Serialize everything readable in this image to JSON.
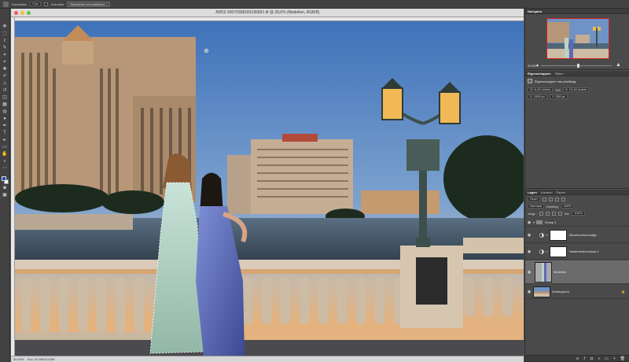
{
  "options_bar": {
    "feather_label": "Doezelaar:",
    "feather_value": "0 px",
    "antialias_label": "Anti-alias",
    "select_mask_button": "Selecteren en maskeren..."
  },
  "document": {
    "title": "JWD2-20070308183195891.tif @ 39,6% (Modellen, RGB/8)",
    "status_zoom": "39,53%",
    "status_doc": "Doc: 32,5M/104,9M"
  },
  "colors": {
    "foreground": "#1b4fb8",
    "background": "#ffffff",
    "selection_frame": "#cf2020"
  },
  "navigator": {
    "tab": "Navigator",
    "zoom": "39,53%"
  },
  "properties": {
    "tabs": [
      "Eigenschappen",
      "Stijlen"
    ],
    "heading": "Eigenschappen van pixellaag",
    "width": "W: 6,45 inches",
    "link": "GO",
    "height": "H: 10,48 inches",
    "x": "X: 1590 px",
    "y": "Y: 308 px"
  },
  "layers": {
    "tabs": [
      "Lagen",
      "Kanalen",
      "Paden"
    ],
    "filter": "Soort",
    "blend_mode": "Normaal",
    "opacity_label": "Dekking:",
    "opacity_value": "100%",
    "lock_label": "Vergr.:",
    "fill_label": "Vul:",
    "fill_value": "100%",
    "items": [
      {
        "name": "Groep 1",
        "type": "group"
      },
      {
        "name": "Kleurtoon/verzadigi...",
        "type": "adjustment"
      },
      {
        "name": "Helderheid/contrast 1",
        "type": "adjustment"
      },
      {
        "name": "Modellen",
        "type": "pixel",
        "selected": true
      },
      {
        "name": "Achtergrond",
        "type": "background"
      }
    ]
  }
}
